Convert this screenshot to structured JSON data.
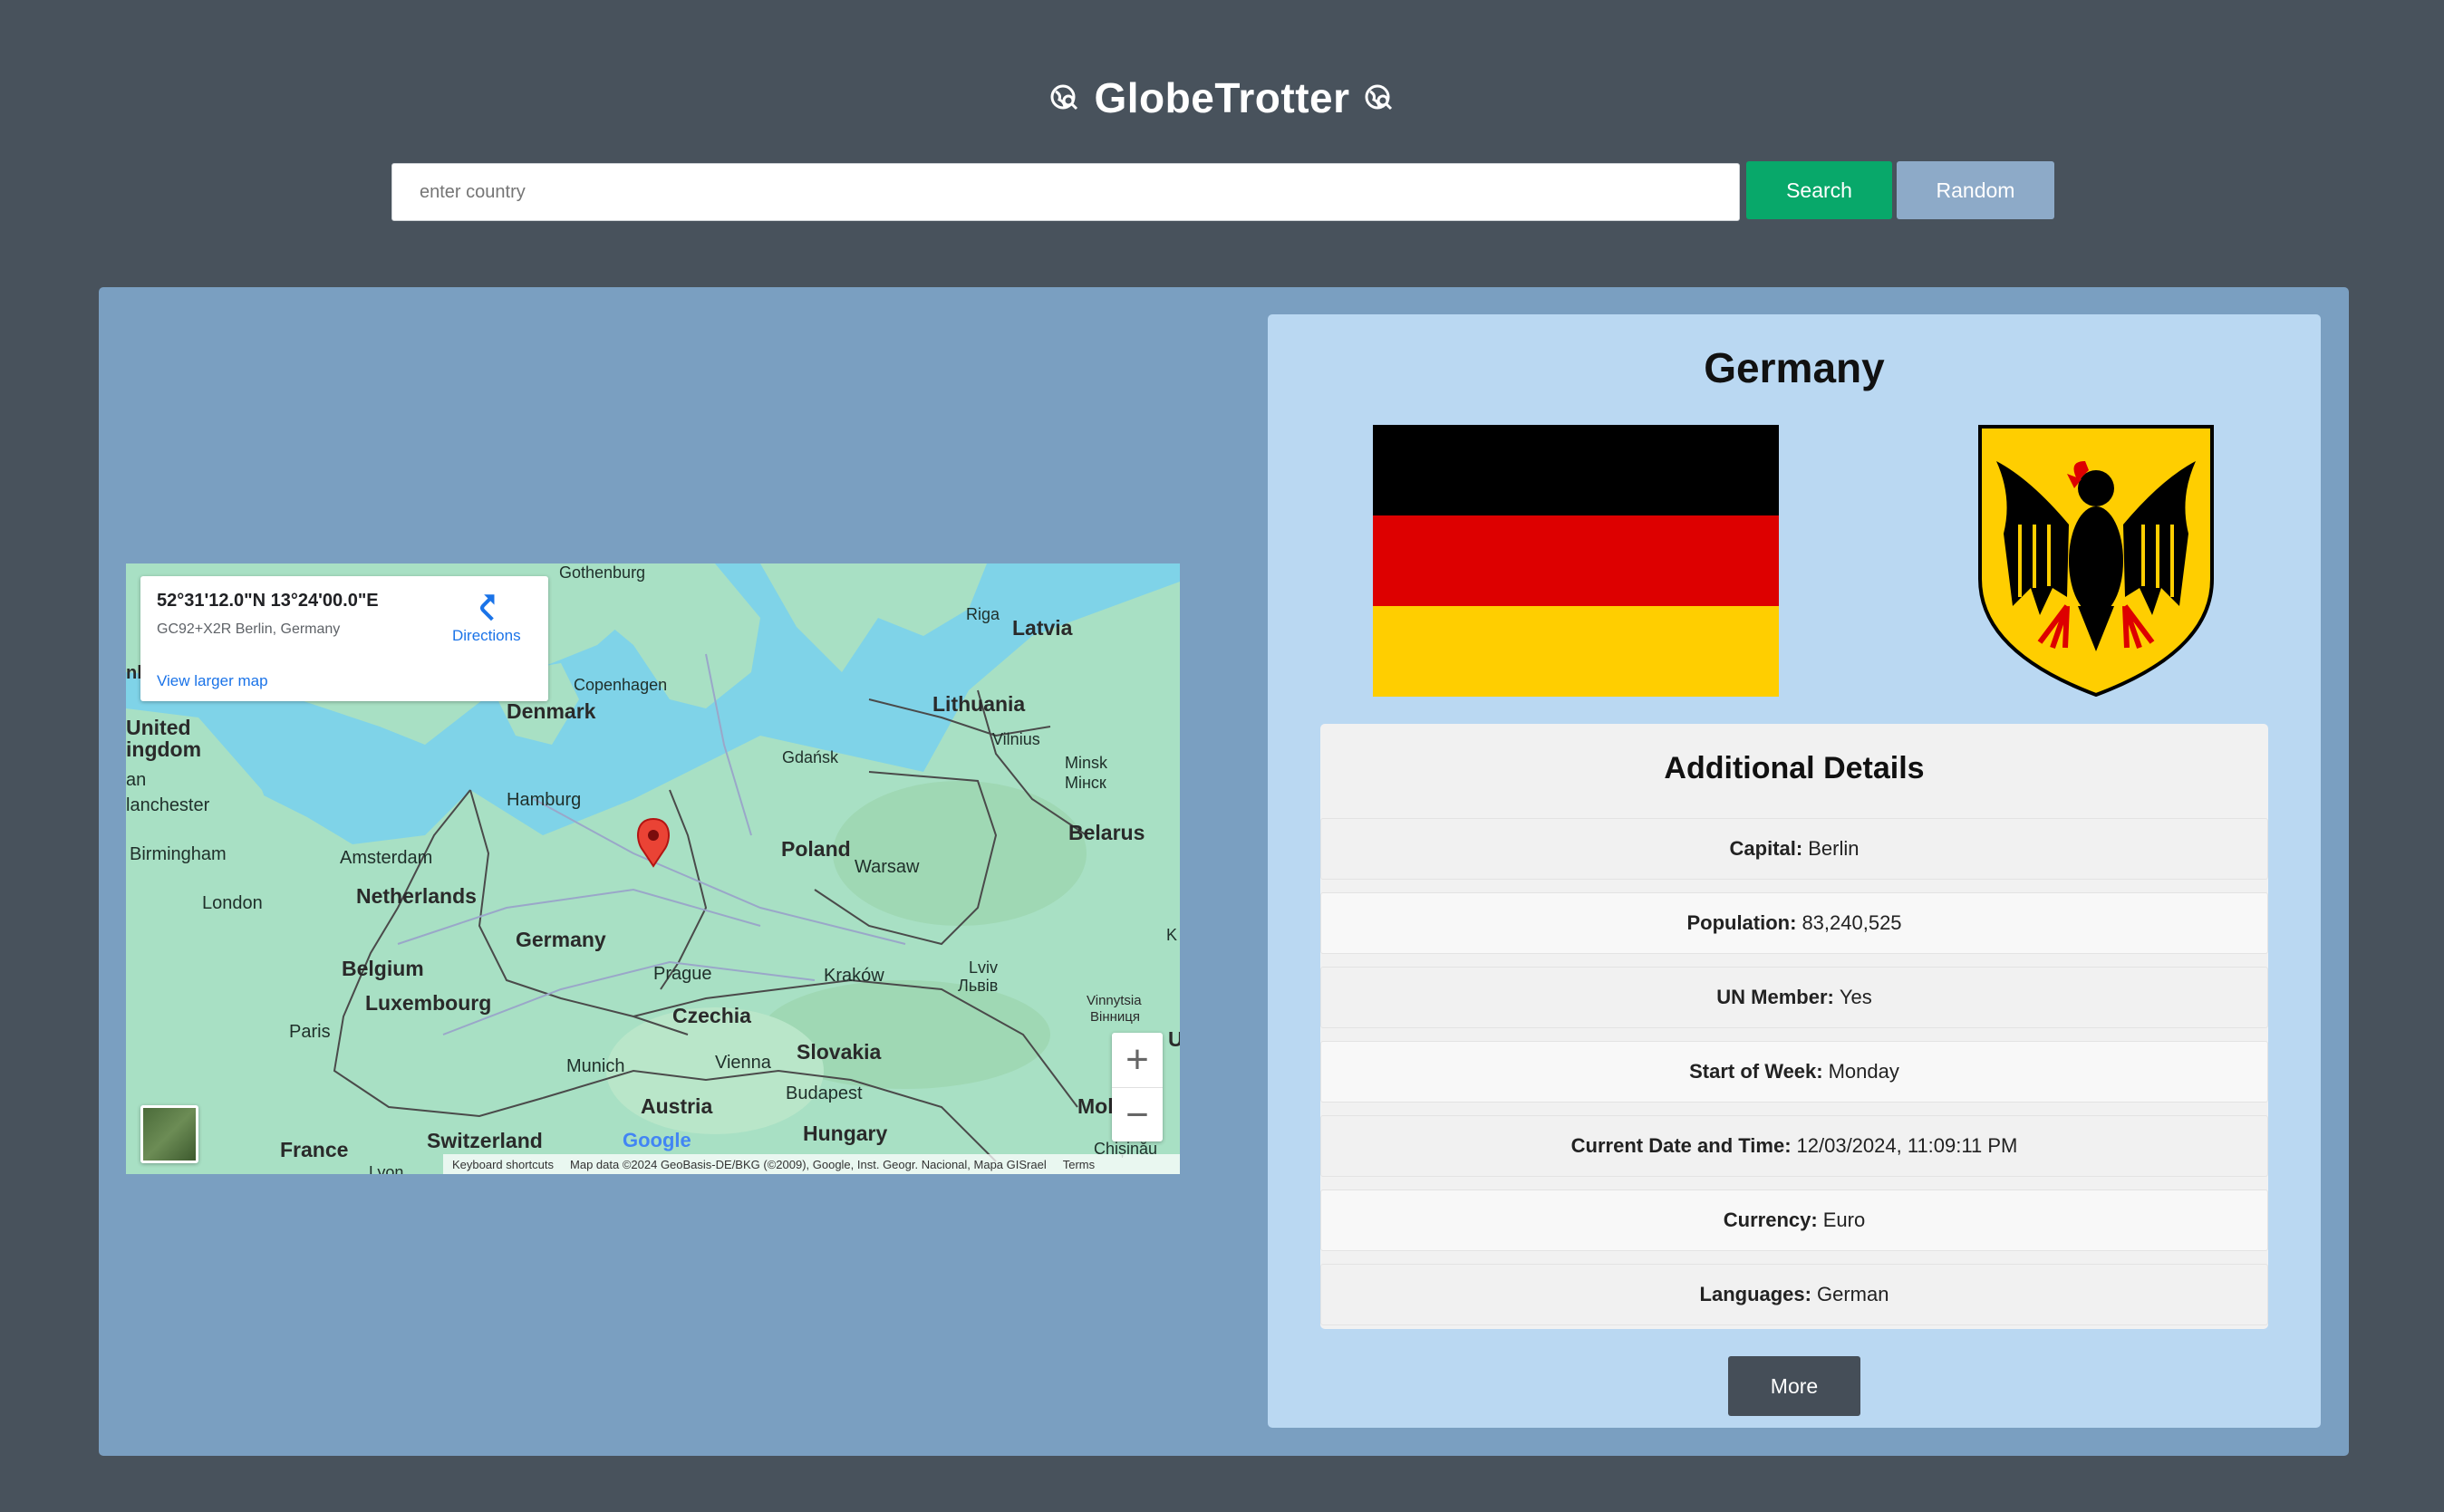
{
  "app": {
    "title": "GlobeTrotter",
    "icon": "globe-search-icon"
  },
  "search": {
    "placeholder": "enter country",
    "value": "",
    "search_label": "Search",
    "random_label": "Random"
  },
  "map": {
    "coordinates": "52°31'12.0\"N 13°24'00.0\"E",
    "address": "GC92+X2R Berlin, Germany",
    "directions_label": "Directions",
    "view_larger_label": "View larger map",
    "zoom_in_label": "+",
    "zoom_out_label": "−",
    "footer": {
      "shortcuts": "Keyboard shortcuts",
      "map_data": "Map data ©2024 GeoBasis-DE/BKG (©2009), Google, Inst. Geogr. Nacional, Mapa GISrael",
      "terms": "Terms"
    },
    "google_logo": "Google",
    "labels": {
      "gothenburg": "Gothenburg",
      "riga": "Riga",
      "latvia": "Latvia",
      "copenhagen": "Copenhagen",
      "denmark": "Denmark",
      "lithuania": "Lithuania",
      "vilnius": "Vilnius",
      "united_kingdom_1": "United",
      "united_kingdom_2": "ingdom",
      "an": "an",
      "manchester": "lanchester",
      "nb": "nb",
      "gdansk": "Gdańsk",
      "minsk_1": "Minsk",
      "minsk_2": "Мінск",
      "hamburg": "Hamburg",
      "belarus": "Belarus",
      "birmingham": "Birmingham",
      "amsterdam": "Amsterdam",
      "poland": "Poland",
      "warsaw": "Warsaw",
      "netherlands": "Netherlands",
      "london": "London",
      "germany": "Germany",
      "belgium": "Belgium",
      "prague": "Prague",
      "krakow": "Kraków",
      "lviv_1": "Lviv",
      "lviv_2": "Львів",
      "k": "K",
      "luxembourg": "Luxembourg",
      "czechia": "Czechia",
      "vinnytsia_1": "Vinnytsia",
      "vinnytsia_2": "Вінниця",
      "paris": "Paris",
      "slovakia": "Slovakia",
      "u": "U",
      "munich": "Munich",
      "vienna": "Vienna",
      "budapest": "Budapest",
      "austria": "Austria",
      "mol": "Mol",
      "hungary": "Hungary",
      "switzerland": "Switzerland",
      "france": "France",
      "chisinau": "Chișinău",
      "lyon": "Lyon"
    }
  },
  "country": {
    "name": "Germany",
    "flag_colors": [
      "#000000",
      "#dd0000",
      "#ffce00"
    ]
  },
  "details": {
    "title": "Additional Details",
    "rows": [
      {
        "key": "Capital:",
        "value": "Berlin"
      },
      {
        "key": "Population:",
        "value": "83,240,525"
      },
      {
        "key": "UN Member:",
        "value": "Yes"
      },
      {
        "key": "Start of Week:",
        "value": "Monday"
      },
      {
        "key": "Current Date and Time:",
        "value": "12/03/2024, 11:09:11 PM"
      },
      {
        "key": "Currency:",
        "value": "Euro"
      },
      {
        "key": "Languages:",
        "value": "German"
      }
    ],
    "more_label": "More"
  },
  "colors": {
    "background": "#48525c",
    "search_button": "#08a86a",
    "random_button": "#8daac8",
    "panel": "#7a9fc1",
    "info_panel": "#bad8f2",
    "more_button": "#454e58"
  }
}
